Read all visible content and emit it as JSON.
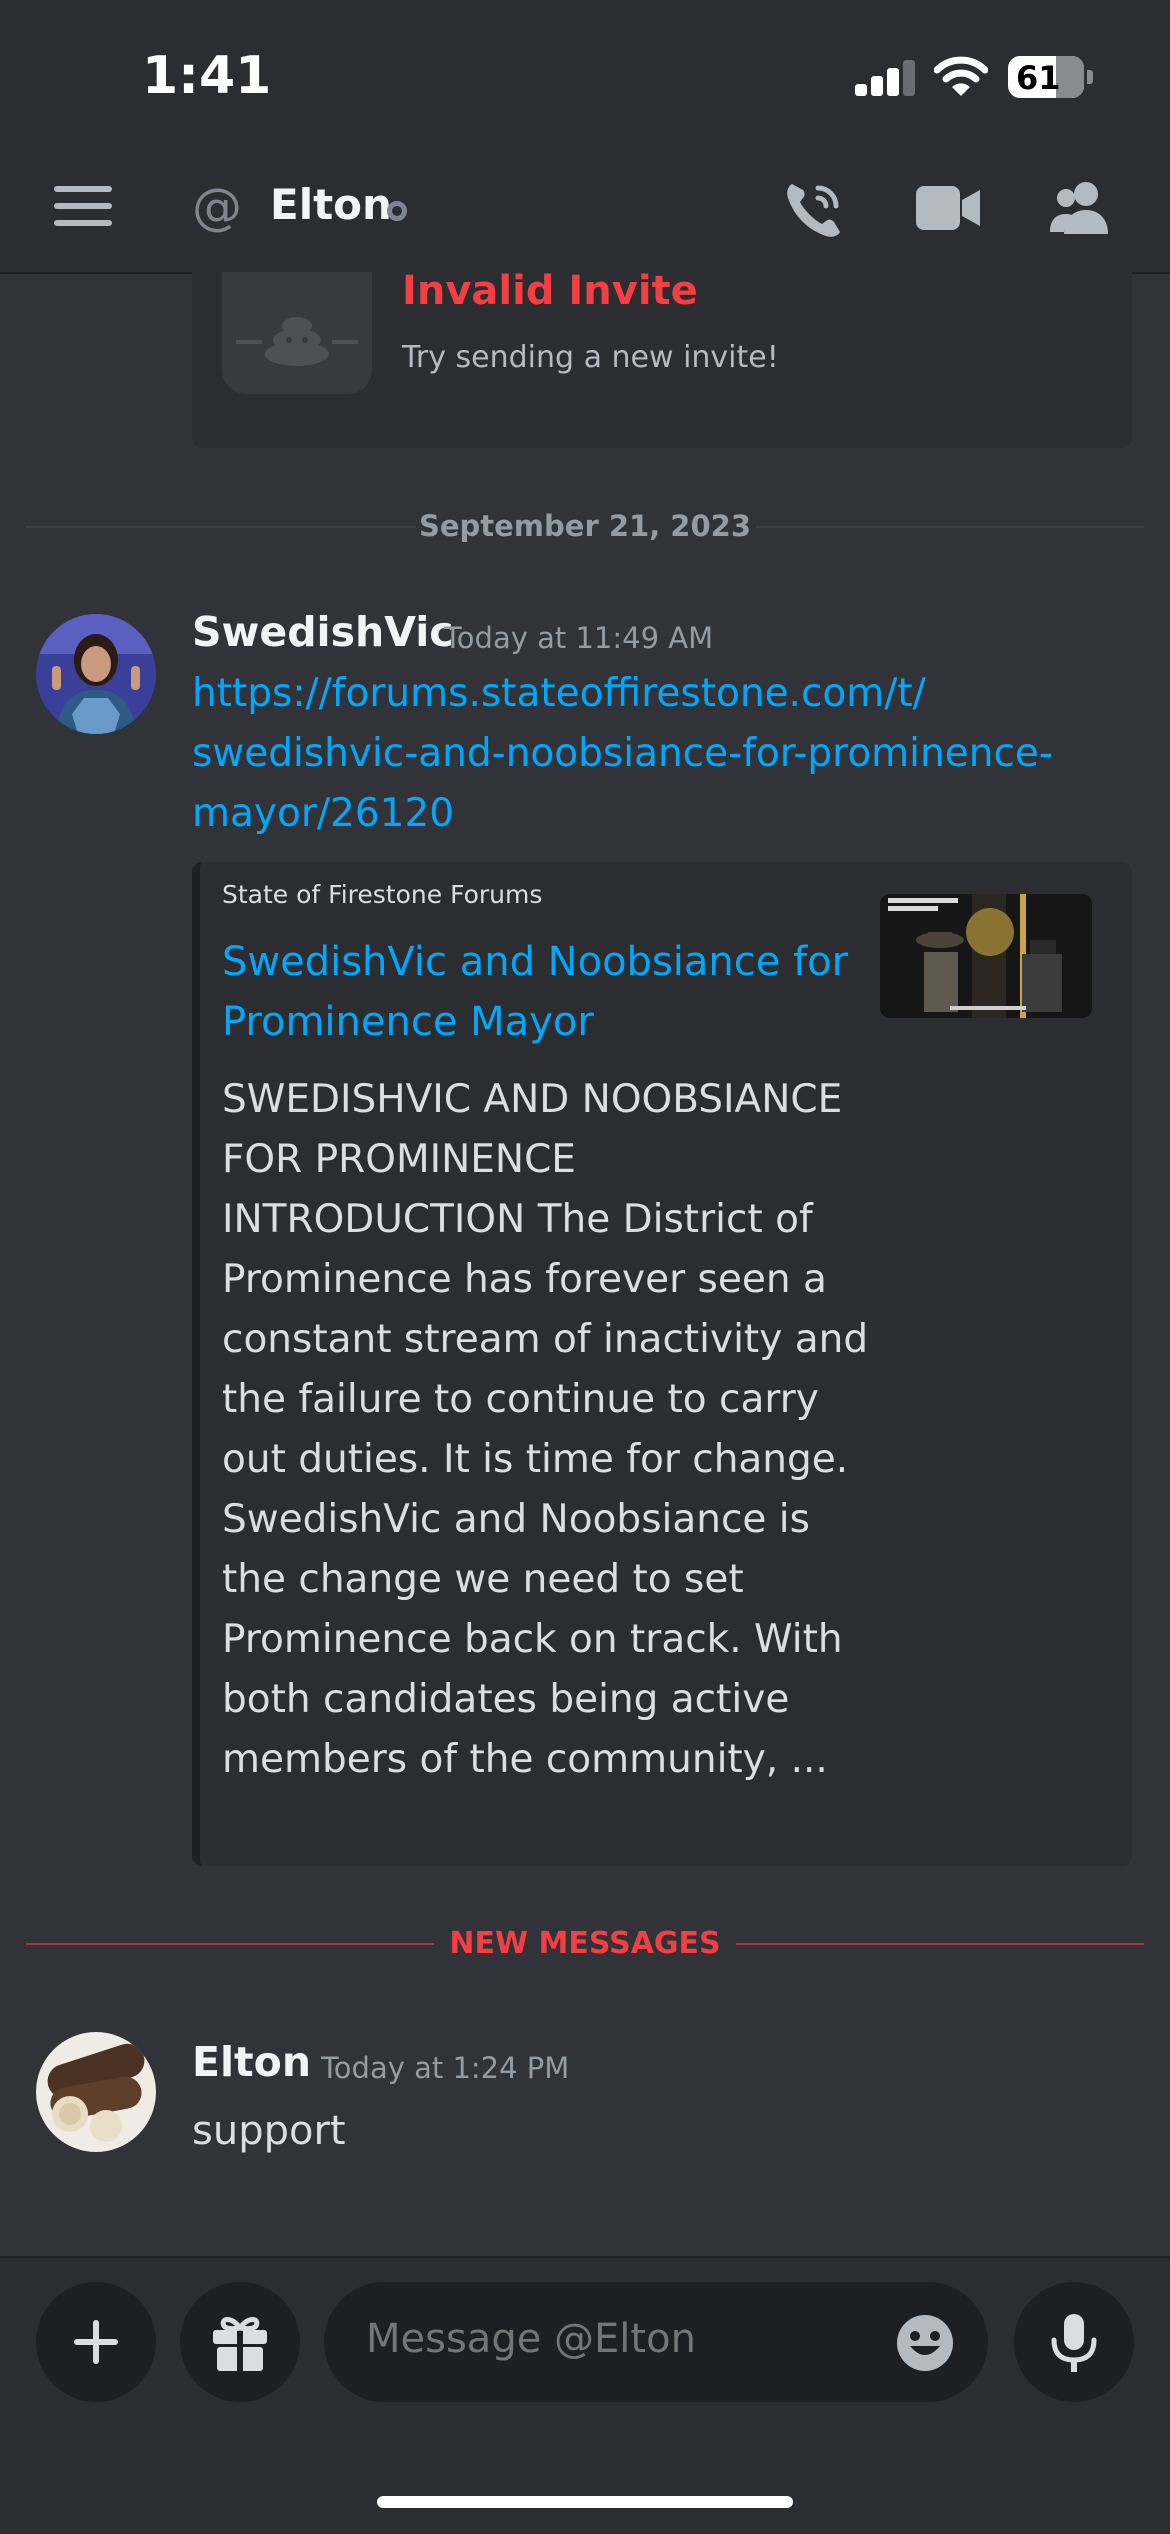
{
  "status_bar": {
    "time": "1:41",
    "battery": "61"
  },
  "header": {
    "title": "Elton",
    "at_symbol": "@"
  },
  "invite": {
    "title": "Invalid Invite",
    "subtitle": "Try sending a new invite!"
  },
  "date_divider": "September 21, 2023",
  "message1": {
    "author": "SwedishVic",
    "timestamp": "Today at 11:49 AM",
    "link_lines": [
      "https://forums.stateoffirestone.com/t/",
      "swedishvic-and-noobsiance-for-prominence-",
      "mayor/26120"
    ],
    "embed": {
      "provider": "State of Firestone Forums",
      "title": "SwedishVic and Noobsiance for Prominence Mayor",
      "description": "SWEDISHVIC AND NOOBSIANCE FOR PROMINENCE INTRODUCTION  The District of Prominence has forever seen a constant stream of inactivity and the failure to continue to carry out duties. It is time for change. SwedishVic and Noobsiance is the change we need to set Prominence back on track. With both candidates being active members of the community, ..."
    }
  },
  "new_messages_label": "NEW MESSAGES",
  "message2": {
    "author": "Elton",
    "timestamp": "Today at 1:24 PM",
    "text": "support"
  },
  "composer": {
    "placeholder": "Message @Elton"
  },
  "colors": {
    "background": "#313338",
    "link": "#00a8fc",
    "danger": "#f23f43"
  },
  "icons": [
    "menu-icon",
    "at-icon",
    "phone-call-icon",
    "video-camera-icon",
    "members-icon",
    "plus-icon",
    "gift-icon",
    "emoji-icon",
    "microphone-icon"
  ]
}
